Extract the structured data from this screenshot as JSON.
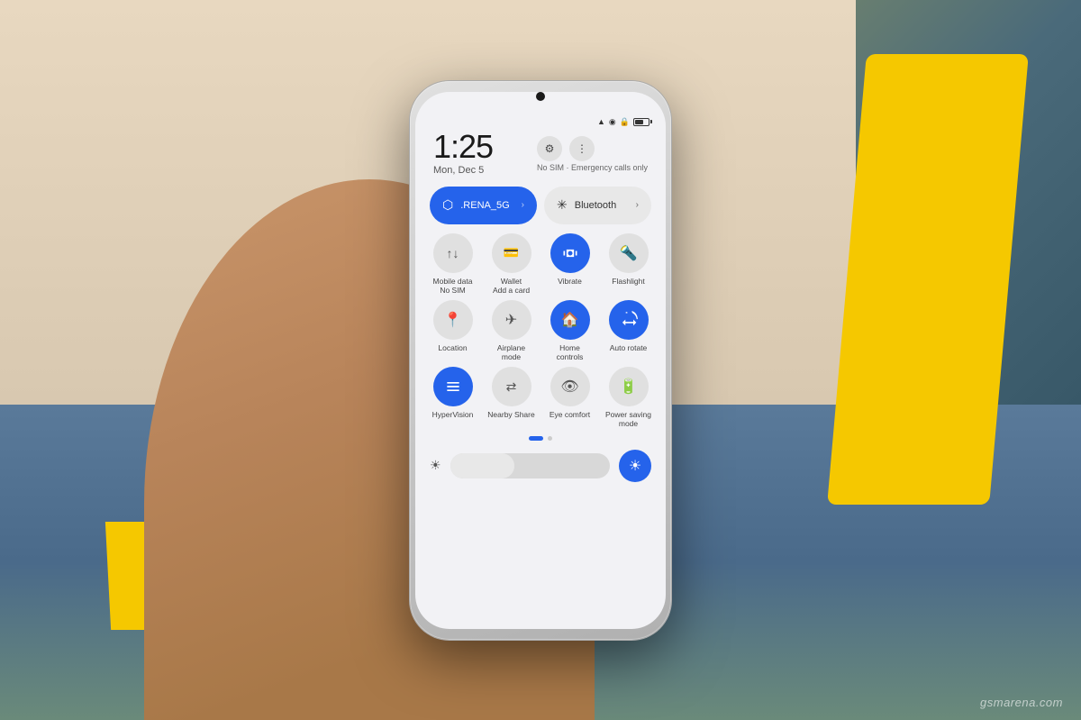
{
  "background": {
    "desc": "Phone held in hand against colorful background"
  },
  "phone": {
    "status_bar": {
      "wifi_icon": "📶",
      "signal_icon": "📡",
      "lock_icon": "🔒",
      "battery_level": 65
    },
    "time": "1:25",
    "date": "Mon, Dec 5",
    "sim_notice": "No SIM · Emergency calls only",
    "settings_icon": "⚙",
    "more_icon": "⋮",
    "wifi_tile": {
      "label": ".RENA_5G",
      "active": true,
      "icon": "📶"
    },
    "bluetooth_tile": {
      "label": "Bluetooth",
      "active": false,
      "icon": "⚡"
    },
    "quick_tiles": [
      {
        "id": "mobile-data",
        "label": "Mobile data\nNo SIM",
        "icon": "↑↓",
        "active": false
      },
      {
        "id": "wallet",
        "label": "Wallet\nAdd a card",
        "icon": "💳",
        "active": false
      },
      {
        "id": "vibrate",
        "label": "Vibrate",
        "icon": "📳",
        "active": true
      },
      {
        "id": "flashlight",
        "label": "Flashlight",
        "icon": "🔦",
        "active": false
      },
      {
        "id": "location",
        "label": "Location",
        "icon": "📍",
        "active": false
      },
      {
        "id": "airplane",
        "label": "Airplane\nmode",
        "icon": "✈",
        "active": false
      },
      {
        "id": "home-controls",
        "label": "Home\ncontrols",
        "icon": "🏠",
        "active": true
      },
      {
        "id": "auto-rotate",
        "label": "Auto rotate",
        "icon": "🔄",
        "active": true
      },
      {
        "id": "hypervision",
        "label": "HyperVision",
        "icon": "▣",
        "active": true
      },
      {
        "id": "nearby-share",
        "label": "Nearby Share",
        "icon": "⇄",
        "active": false
      },
      {
        "id": "eye-comfort",
        "label": "Eye comfort",
        "icon": "👁",
        "active": false
      },
      {
        "id": "power-saving",
        "label": "Power saving\nmode",
        "icon": "🔋",
        "active": false
      }
    ],
    "brightness": {
      "level": 40,
      "icon": "☀"
    },
    "dots": [
      {
        "active": true
      },
      {
        "active": false
      }
    ]
  },
  "watermark": {
    "text": "gsmarena.com"
  }
}
